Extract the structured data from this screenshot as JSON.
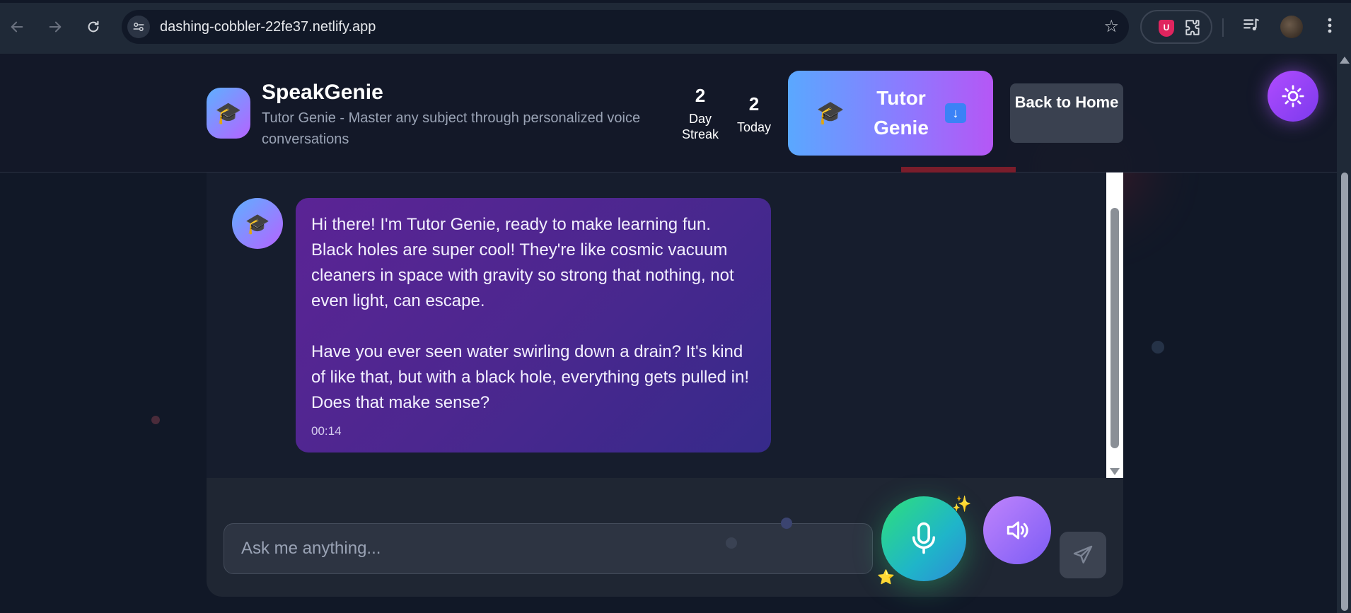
{
  "browser": {
    "url": "dashing-cobbler-22fe37.netlify.app"
  },
  "header": {
    "app_title": "SpeakGenie",
    "subtitle": "Tutor Genie - Master any subject through personalized voice conversations",
    "stats": [
      {
        "value": "2",
        "label": "Day Streak"
      },
      {
        "value": "2",
        "label": "Today"
      }
    ],
    "tutor_button_label": "Tutor Genie",
    "tutor_button_icon": "graduation-cap-icon",
    "tutor_button_badge": "⬇️",
    "back_button_label": "Back to Home"
  },
  "chat": {
    "messages": [
      {
        "sender": "Tutor Genie",
        "paragraphs": [
          "Hi there! I'm Tutor Genie, ready to make learning fun. Black holes are super cool! They're like cosmic vacuum cleaners in space with gravity so strong that nothing, not even light, can escape.",
          "Have you ever seen water swirling down a drain? It's kind of like that, but with a black hole, everything gets pulled in! Does that make sense?"
        ],
        "time": "00:14"
      }
    ]
  },
  "composer": {
    "placeholder": "Ask me anything..."
  },
  "colors": {
    "bubble_gradient": [
      "#5b2495",
      "#362a8a"
    ],
    "mic_gradient": [
      "#2ee07a",
      "#2d8bd6"
    ],
    "accent_purple": "#a855f7"
  }
}
